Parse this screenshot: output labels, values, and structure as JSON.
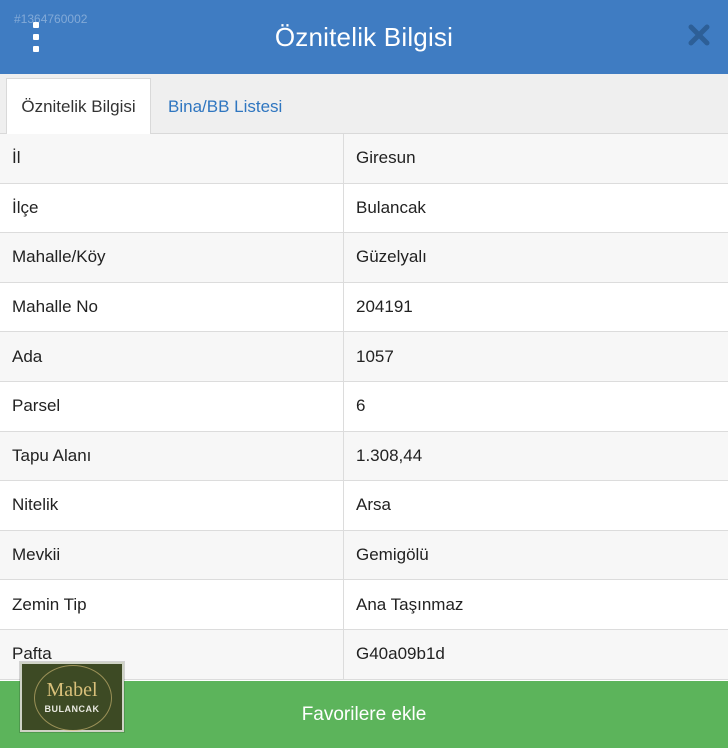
{
  "header": {
    "title": "Öznitelik Bilgisi",
    "watermark_id": "#1364760002",
    "menu_icon": "vertical-dots-icon",
    "close_icon": "close-icon",
    "color": "#3f7cc2"
  },
  "tabs": [
    {
      "label": "Öznitelik Bilgisi",
      "active": true
    },
    {
      "label": "Bina/BB Listesi",
      "active": false
    }
  ],
  "attributes": [
    {
      "key": "İl",
      "value": "Giresun"
    },
    {
      "key": "İlçe",
      "value": "Bulancak"
    },
    {
      "key": "Mahalle/Köy",
      "value": "Güzelyalı"
    },
    {
      "key": "Mahalle No",
      "value": "204191"
    },
    {
      "key": "Ada",
      "value": "1057"
    },
    {
      "key": "Parsel",
      "value": "6"
    },
    {
      "key": "Tapu Alanı",
      "value": "1.308,44"
    },
    {
      "key": "Nitelik",
      "value": "Arsa"
    },
    {
      "key": "Mevkii",
      "value": "Gemigölü"
    },
    {
      "key": "Zemin Tip",
      "value": "Ana Taşınmaz"
    },
    {
      "key": "Pafta",
      "value": "G40a09b1d"
    }
  ],
  "footer": {
    "button_label": "Favorilere ekle",
    "color": "#5cb45b"
  },
  "logo": {
    "mark": "Mabel",
    "sub": "BULANCAK"
  }
}
